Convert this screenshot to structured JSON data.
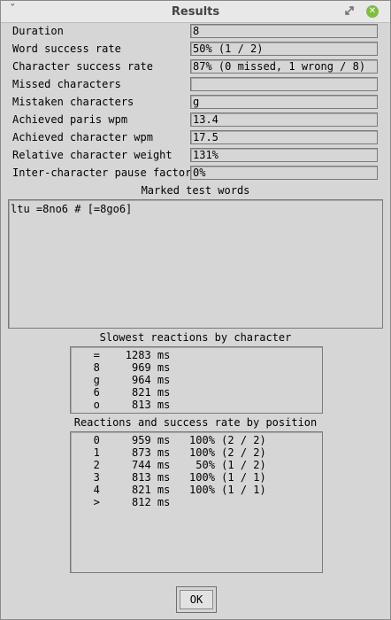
{
  "window": {
    "title": "Results",
    "menu_glyph": "ˇ",
    "close_glyph": "✕"
  },
  "fields": [
    {
      "label": "Duration",
      "value": "8"
    },
    {
      "label": "Word success rate",
      "value": "50% (1 / 2)"
    },
    {
      "label": "Character success rate",
      "value": "87% (0 missed, 1 wrong / 8)"
    },
    {
      "label": "Missed characters",
      "value": ""
    },
    {
      "label": "Mistaken characters",
      "value": "g"
    },
    {
      "label": "Achieved paris wpm",
      "value": "13.4"
    },
    {
      "label": "Achieved character wpm",
      "value": "17.5"
    },
    {
      "label": "Relative character weight",
      "value": "131%"
    },
    {
      "label": "Inter-character pause factor",
      "value": "0%"
    }
  ],
  "marked": {
    "label": "Marked test words",
    "text": "ltu =8no6 # [=8go6]"
  },
  "slowest": {
    "label": "Slowest reactions by character",
    "lines": [
      "   =    1283 ms",
      "   8     969 ms",
      "   g     964 ms",
      "   6     821 ms",
      "   o     813 ms"
    ]
  },
  "positions": {
    "label": "Reactions and success rate by position",
    "lines": [
      "   0     959 ms   100% (2 / 2)",
      "   1     873 ms   100% (2 / 2)",
      "   2     744 ms    50% (1 / 2)",
      "   3     813 ms   100% (1 / 1)",
      "   4     821 ms   100% (1 / 1)",
      "   >     812 ms"
    ]
  },
  "footer": {
    "ok_label": "OK"
  }
}
